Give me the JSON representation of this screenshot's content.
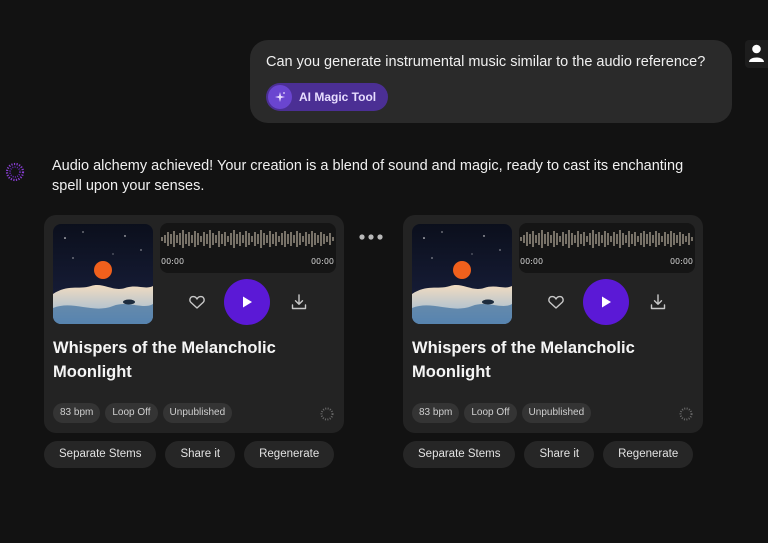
{
  "user_message": {
    "text": "Can you generate instrumental music similar to the audio reference?",
    "tool_chip": {
      "label": "AI Magic Tool",
      "icon": "sparkle-icon"
    },
    "avatar_icon": "user-icon"
  },
  "assistant_message": {
    "avatar_icon": "spark-ring-icon",
    "text": "Audio alchemy achieved! Your creation is a blend of sound and magic, ready to cast its enchanting spell upon your senses."
  },
  "tracks": [
    {
      "title": "Whispers of the Melancholic Moonlight",
      "time_start": "00:00",
      "time_end": "00:00",
      "tags": [
        "83 bpm",
        "Loop Off",
        "Unpublished"
      ],
      "actions": [
        "Separate Stems",
        "Share it",
        "Regenerate"
      ]
    },
    {
      "title": "Whispers of the Melancholic Moonlight",
      "time_start": "00:00",
      "time_end": "00:00",
      "tags": [
        "83 bpm",
        "Loop Off",
        "Unpublished"
      ],
      "actions": [
        "Separate Stems",
        "Share it",
        "Regenerate"
      ]
    }
  ],
  "colors": {
    "background": "#121212",
    "card": "#232323",
    "accent_purple": "#5b19d6",
    "chip_purple": "#4b2f94",
    "waveform": "#cbbfae"
  }
}
